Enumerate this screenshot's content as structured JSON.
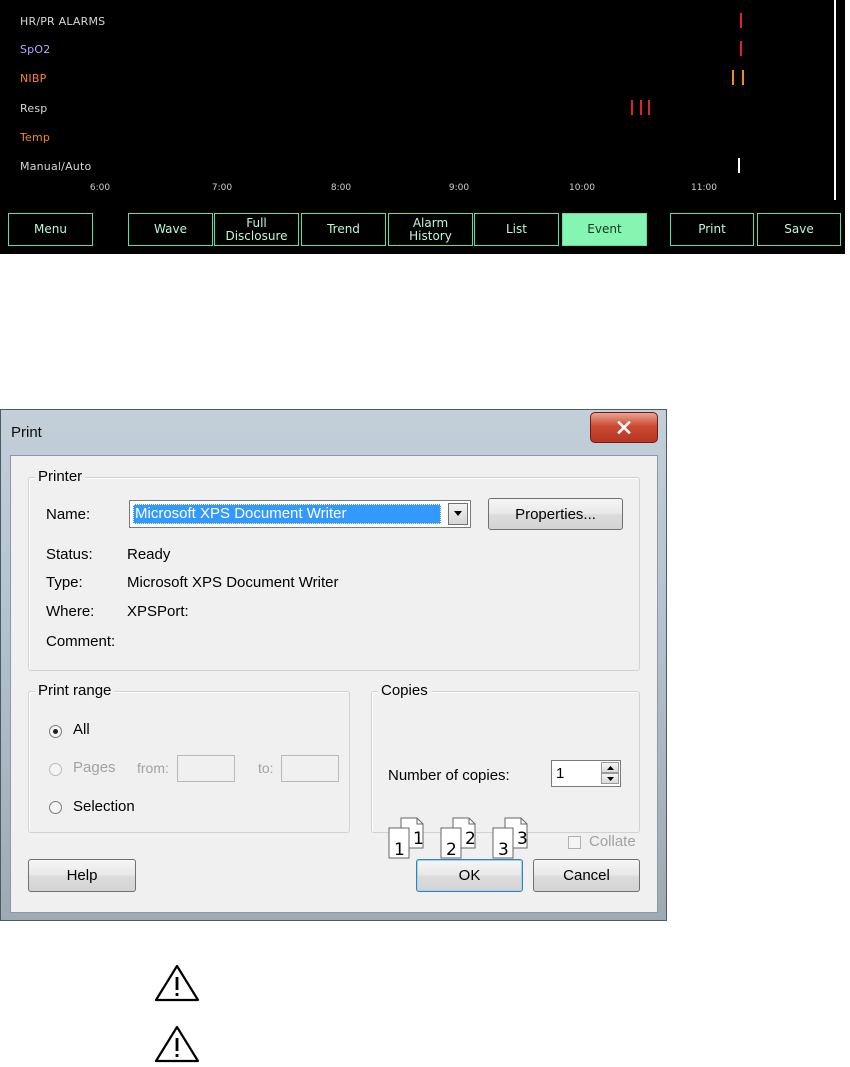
{
  "monitor": {
    "rows": [
      {
        "label": "HR/PR ALARMS",
        "color": "#d6d6d6",
        "marks": [
          {
            "at": 0.876,
            "color": "#e0222a"
          }
        ]
      },
      {
        "label": "SpO2",
        "color": "#b3a8ff",
        "marks": [
          {
            "at": 0.876,
            "color": "#e0222a"
          }
        ]
      },
      {
        "label": "NIBP",
        "color": "#f08a20",
        "marks": [
          {
            "at": 0.866,
            "color": "#f08a20"
          },
          {
            "at": 0.878,
            "color": "#f08a20"
          }
        ]
      },
      {
        "label": "Resp",
        "color": "#d6d6d6",
        "marks": [
          {
            "at": 0.747,
            "color": "#e0222a"
          },
          {
            "at": 0.757,
            "color": "#e0222a"
          },
          {
            "at": 0.767,
            "color": "#e0222a"
          }
        ]
      },
      {
        "label": "Temp",
        "color": "#f08a20",
        "marks": []
      },
      {
        "label": "Manual/Auto",
        "color": "#d6d6d6",
        "marks": [
          {
            "at": 0.873,
            "color": "#ffffff"
          }
        ]
      }
    ],
    "ticks": [
      "6:00",
      "7:00",
      "8:00",
      "9:00",
      "10:00",
      "11:00"
    ],
    "buttons": [
      {
        "label": "Menu",
        "active": false
      },
      {
        "label": "Wave",
        "active": false
      },
      {
        "label": "Full\nDisclosure",
        "active": false
      },
      {
        "label": "Trend",
        "active": false
      },
      {
        "label": "Alarm\nHistory",
        "active": false
      },
      {
        "label": "List",
        "active": false
      },
      {
        "label": "Event",
        "active": true
      },
      {
        "label": "Print",
        "active": false
      },
      {
        "label": "Save",
        "active": false
      }
    ]
  },
  "dialog": {
    "title": "Print",
    "close_icon": "close-icon",
    "printer": {
      "group_label": "Printer",
      "name_label": "Name:",
      "name_value": "Microsoft XPS Document Writer",
      "properties_button": "Properties...",
      "status_label": "Status:",
      "status_value": "Ready",
      "type_label": "Type:",
      "type_value": "Microsoft XPS Document Writer",
      "where_label": "Where:",
      "where_value": "XPSPort:",
      "comment_label": "Comment:",
      "comment_value": ""
    },
    "print_range": {
      "group_label": "Print range",
      "all_label": "All",
      "pages_label": "Pages",
      "from_label": "from:",
      "to_label": "to:",
      "from_value": "",
      "to_value": "",
      "selection_label": "Selection",
      "selected": "All"
    },
    "copies": {
      "group_label": "Copies",
      "number_label": "Number of copies:",
      "number_value": "1",
      "collate_label": "Collate",
      "collate_checked": false
    },
    "buttons": {
      "help": "Help",
      "ok": "OK",
      "cancel": "Cancel"
    }
  },
  "warnings": [
    {
      "icon": "warning-icon"
    },
    {
      "icon": "warning-icon"
    }
  ]
}
